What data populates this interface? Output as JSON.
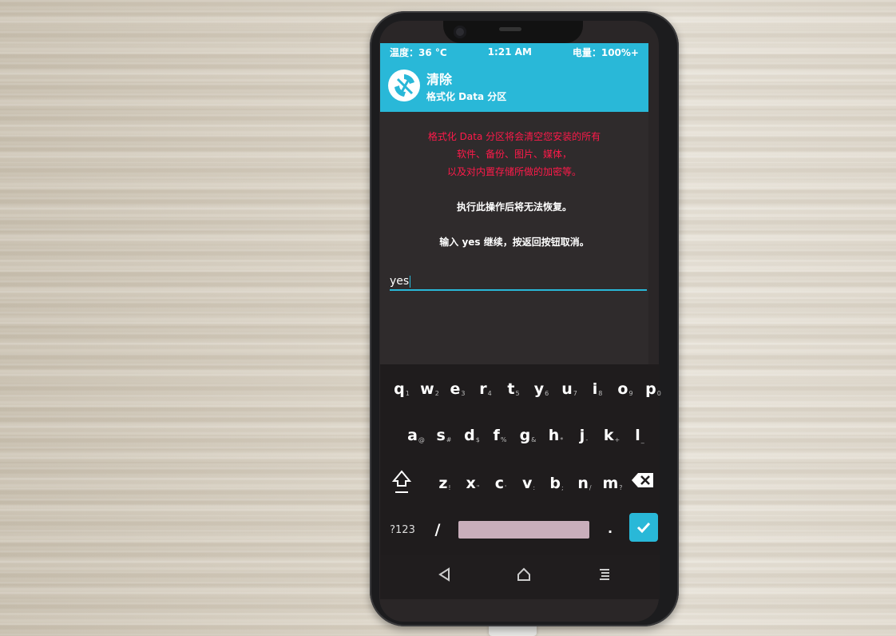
{
  "status": {
    "temp": "温度：36 °C",
    "time": "1:21 AM",
    "battery": "电量：100%+"
  },
  "header": {
    "title": "清除",
    "subtitle": "格式化 Data 分区"
  },
  "warning_lines": [
    "格式化 Data 分区将会清空您安装的所有",
    "软件、备份、图片、媒体，",
    "以及对内置存储所做的加密等。"
  ],
  "notice": "执行此操作后将无法恢复。",
  "instruction": "输入 yes 继续，按返回按钮取消。",
  "input": {
    "value": "yes"
  },
  "keyboard": {
    "row1": [
      [
        "q",
        "1"
      ],
      [
        "w",
        "2"
      ],
      [
        "e",
        "3"
      ],
      [
        "r",
        "4"
      ],
      [
        "t",
        "5"
      ],
      [
        "y",
        "6"
      ],
      [
        "u",
        "7"
      ],
      [
        "i",
        "8"
      ],
      [
        "o",
        "9"
      ],
      [
        "p",
        "0"
      ]
    ],
    "row2": [
      [
        "a",
        "@"
      ],
      [
        "s",
        "#"
      ],
      [
        "d",
        "$"
      ],
      [
        "f",
        "%"
      ],
      [
        "g",
        "&"
      ],
      [
        "h",
        "*"
      ],
      [
        "j",
        "-"
      ],
      [
        "k",
        "+"
      ],
      [
        "l",
        "_"
      ]
    ],
    "row3": [
      [
        "z",
        "!"
      ],
      [
        "x",
        "\""
      ],
      [
        "c",
        "'"
      ],
      [
        "v",
        ":"
      ],
      [
        "b",
        ";"
      ],
      [
        "n",
        "/"
      ],
      [
        "m",
        "?"
      ]
    ],
    "symbols_label": "?123",
    "slash": "/",
    "period": "."
  },
  "colors": {
    "accent": "#29b8d8",
    "warning": "#ff1a4a",
    "background": "#2f2b2c"
  },
  "icons": [
    "twrp-logo-icon",
    "shift-icon",
    "backspace-icon",
    "check-icon",
    "back-icon",
    "home-icon",
    "menu-icon"
  ]
}
